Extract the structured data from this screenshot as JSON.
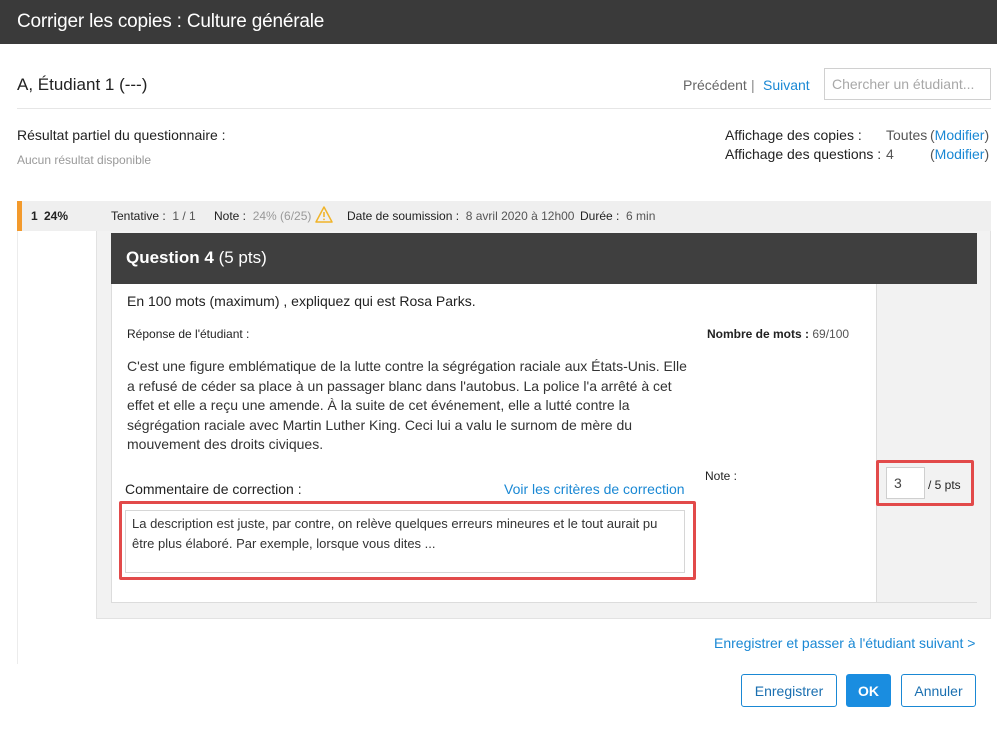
{
  "dialog": {
    "title": "Corriger les copies : Culture générale"
  },
  "student": {
    "name": "A, Étudiant 1 (---)",
    "prev_label": "Précédent",
    "separator": "|",
    "next_label": "Suivant",
    "search_placeholder": "Chercher un étudiant...",
    "search_value": ""
  },
  "partial_result": {
    "label": "Résultat partiel du questionnaire :",
    "value": "Aucun résultat disponible"
  },
  "display": {
    "copies_label": "Affichage des copies :",
    "copies_value": "Toutes",
    "questions_label": "Affichage des questions :",
    "questions_value": "4",
    "open_paren": "(",
    "close_paren": ")",
    "modify_label": "Modifier"
  },
  "attempt": {
    "number": "1",
    "percent": "24%",
    "attempt_label": "Tentative :",
    "attempt_value": "1 / 1",
    "note_label": "Note :",
    "note_value": "24% (6/25)",
    "date_label": "Date de soumission :",
    "date_value": "8 avril 2020 à 12h00",
    "duration_label": "Durée :",
    "duration_value": "6 min",
    "accent_color": "#f39a2c",
    "warning_color": "#f0b429"
  },
  "question": {
    "title": "Question 4",
    "points": "(5 pts)",
    "prompt": "En 100 mots (maximum) , expliquez qui est Rosa Parks.",
    "response_label": "Réponse de l'étudiant :",
    "word_count_label": "Nombre de mots :",
    "word_count_value": "69/100",
    "response_text": "C'est une figure emblématique de la lutte contre la ségrégation raciale aux États-Unis. Elle a refusé de céder sa place à un passager blanc dans l'autobus. La police l'a arrêté à cet effet et elle a reçu une amende. À la suite de cet événement, elle a lutté contre la ségrégation raciale avec Martin Luther King. Ceci lui a valu le surnom de mère du mouvement des droits civiques.",
    "note_label": "Note :",
    "grade_value": "3",
    "grade_max": "/ 5 pts",
    "comment_label": "Commentaire de correction :",
    "criteria_link": "Voir les critères de correction",
    "comment_text": "La description est juste, par contre, on relève quelques erreurs mineures et le tout aurait pu être plus élaboré. Par exemple, lorsque vous dites ...",
    "highlight_color": "#e24a4a"
  },
  "footer": {
    "save_next_link": "Enregistrer et passer à l'étudiant suivant >",
    "save_button": "Enregistrer",
    "ok_button": "OK",
    "cancel_button": "Annuler",
    "primary_color": "#1a8de0"
  }
}
